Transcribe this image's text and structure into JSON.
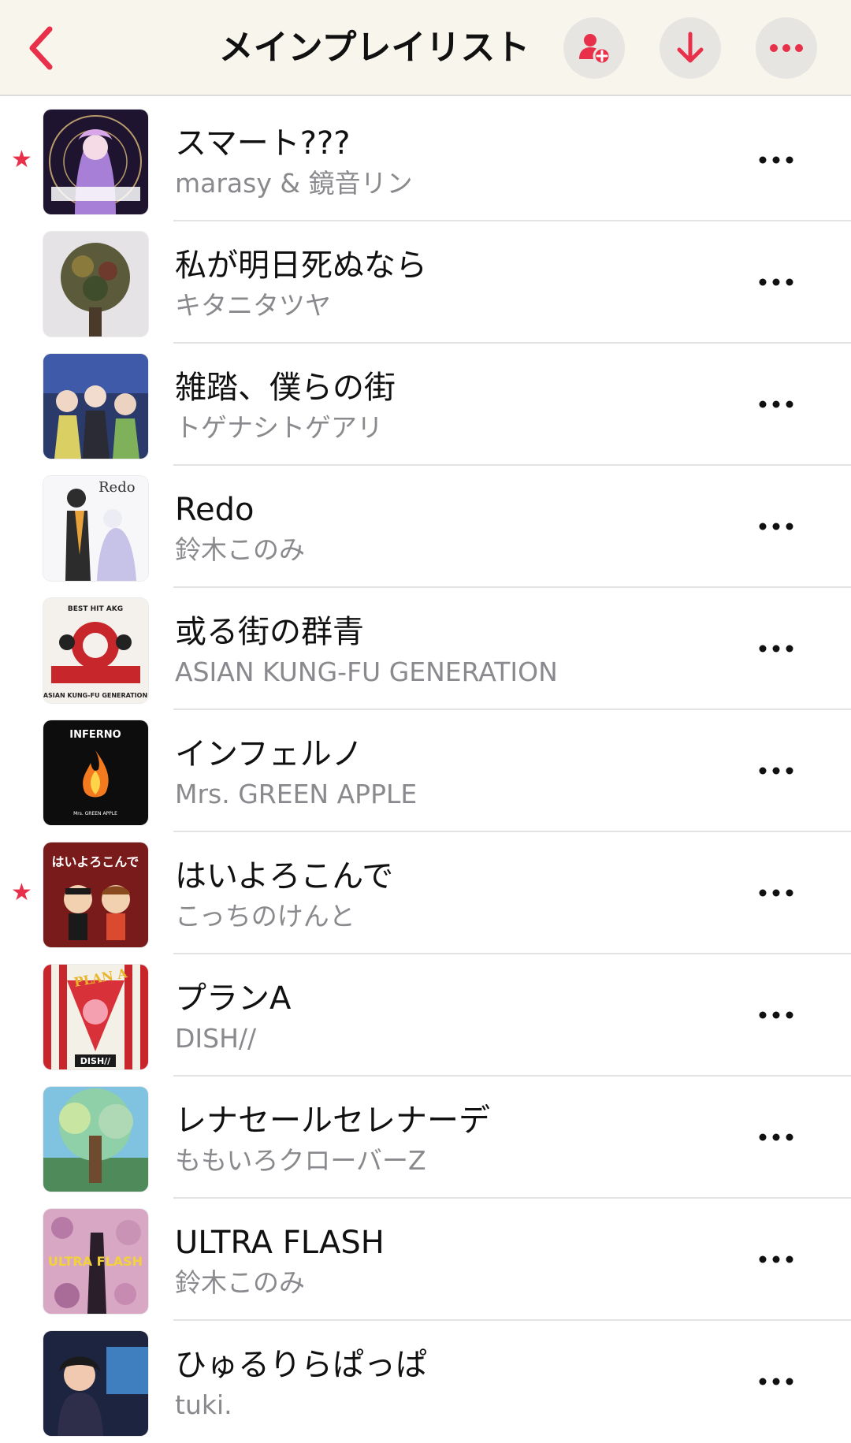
{
  "colors": {
    "accent": "#e8304a",
    "nav_background": "#f8f5ec",
    "nav_button_background": "#e6e5e2",
    "secondary_text": "#8a8a8e"
  },
  "header": {
    "title": "メインプレイリスト",
    "back_icon": "chevron-left-icon",
    "buttons": [
      {
        "icon": "add-person-icon"
      },
      {
        "icon": "download-arrow-icon"
      },
      {
        "icon": "ellipsis-icon"
      }
    ]
  },
  "songs": [
    {
      "title": "スマート???",
      "artist": "marasy & 鏡音リン",
      "favorite": true
    },
    {
      "title": "私が明日死ぬなら",
      "artist": "キタニタツヤ",
      "favorite": false
    },
    {
      "title": "雑踏、僕らの街",
      "artist": "トゲナシトゲアリ",
      "favorite": false
    },
    {
      "title": "Redo",
      "artist": "鈴木このみ",
      "favorite": false,
      "art_text": "Redo"
    },
    {
      "title": "或る街の群青",
      "artist": "ASIAN KUNG-FU GENERATION",
      "favorite": false,
      "art_text": "BEST HIT AKG",
      "art_text_2": "ASIAN KUNG-FU GENERATION"
    },
    {
      "title": "インフェルノ",
      "artist": "Mrs. GREEN APPLE",
      "favorite": false,
      "art_text": "INFERNO",
      "art_text_2": "Mrs. GREEN APPLE"
    },
    {
      "title": "はいよろこんで",
      "artist": "こっちのけんと",
      "favorite": true,
      "art_text": "はいよろこんで"
    },
    {
      "title": "プランA",
      "artist": "DISH//",
      "favorite": false,
      "art_text": "PLAN A",
      "art_text_2": "DISH//"
    },
    {
      "title": "レナセールセレナーデ",
      "artist": "ももいろクローバーZ",
      "favorite": false
    },
    {
      "title": "ULTRA FLASH",
      "artist": "鈴木このみ",
      "favorite": false,
      "art_text": "ULTRA FLASH"
    },
    {
      "title": "ひゅるりらぱっぱ",
      "artist": "tuki.",
      "favorite": false
    }
  ]
}
